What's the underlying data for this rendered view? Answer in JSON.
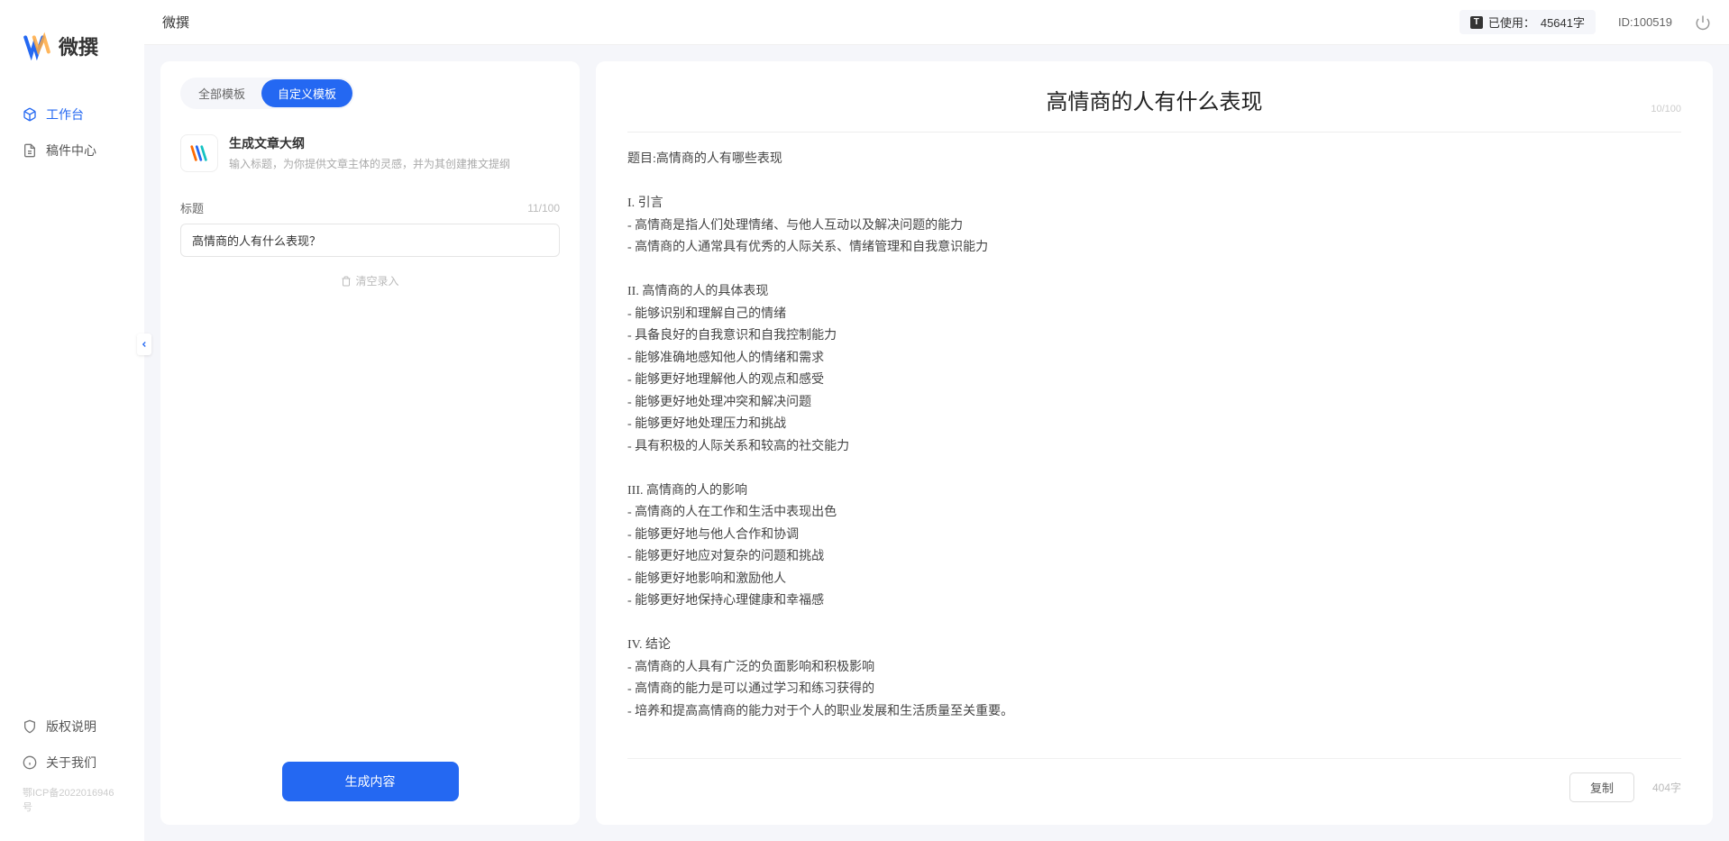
{
  "brand": {
    "name": "微撰"
  },
  "topbar": {
    "app_title": "微撰",
    "usage_label": "已使用：",
    "usage_value": "45641字",
    "user_id": "ID:100519"
  },
  "sidebar": {
    "items": [
      {
        "label": "工作台",
        "icon": "cube",
        "active": true
      },
      {
        "label": "稿件中心",
        "icon": "doc",
        "active": false
      }
    ],
    "footer": [
      {
        "label": "版权说明",
        "icon": "shield"
      },
      {
        "label": "关于我们",
        "icon": "info"
      }
    ],
    "icp": "鄂ICP备2022016946号"
  },
  "left": {
    "tabs": [
      {
        "label": "全部模板",
        "active": false
      },
      {
        "label": "自定义模板",
        "active": true
      }
    ],
    "template": {
      "title": "生成文章大纲",
      "desc": "输入标题，为你提供文章主体的灵感，并为其创建推文提纲"
    },
    "field": {
      "label": "标题",
      "counter": "11/100",
      "value": "高情商的人有什么表现？"
    },
    "clear_label": "清空录入",
    "generate_label": "生成内容"
  },
  "output": {
    "title": "高情商的人有什么表现",
    "title_counter": "10/100",
    "body": "题目:高情商的人有哪些表现\n\nI. 引言\n- 高情商是指人们处理情绪、与他人互动以及解决问题的能力\n- 高情商的人通常具有优秀的人际关系、情绪管理和自我意识能力\n\nII. 高情商的人的具体表现\n- 能够识别和理解自己的情绪\n- 具备良好的自我意识和自我控制能力\n- 能够准确地感知他人的情绪和需求\n- 能够更好地理解他人的观点和感受\n- 能够更好地处理冲突和解决问题\n- 能够更好地处理压力和挑战\n- 具有积极的人际关系和较高的社交能力\n\nIII. 高情商的人的影响\n- 高情商的人在工作和生活中表现出色\n- 能够更好地与他人合作和协调\n- 能够更好地应对复杂的问题和挑战\n- 能够更好地影响和激励他人\n- 能够更好地保持心理健康和幸福感\n\nIV. 结论\n- 高情商的人具有广泛的负面影响和积极影响\n- 高情商的能力是可以通过学习和练习获得的\n- 培养和提高高情商的能力对于个人的职业发展和生活质量至关重要。",
    "copy_label": "复制",
    "char_count": "404字"
  }
}
